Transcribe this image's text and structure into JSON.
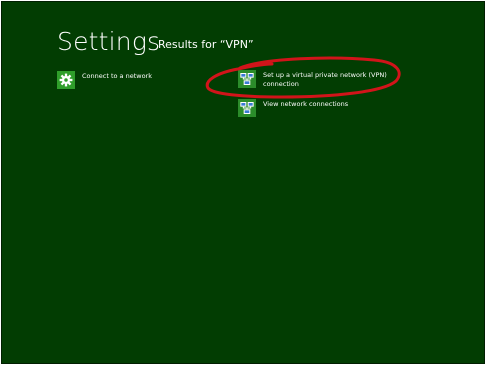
{
  "header": {
    "title": "Settings",
    "subtitle": "Results for “VPN”"
  },
  "results": [
    {
      "label": "Connect to a network",
      "icon": "gear-icon"
    },
    {
      "label": "Set up a virtual private network (VPN) connection",
      "icon": "network-icon"
    },
    {
      "label": "View network connections",
      "icon": "network-icon"
    }
  ],
  "annotation": {
    "kind": "hand-drawn ellipse",
    "color": "#d1141a",
    "target": "Set up a virtual private network (VPN) connection"
  },
  "colors": {
    "background": "#023d02",
    "tile_green": "#2f9e2a",
    "text": "#ffffff"
  }
}
